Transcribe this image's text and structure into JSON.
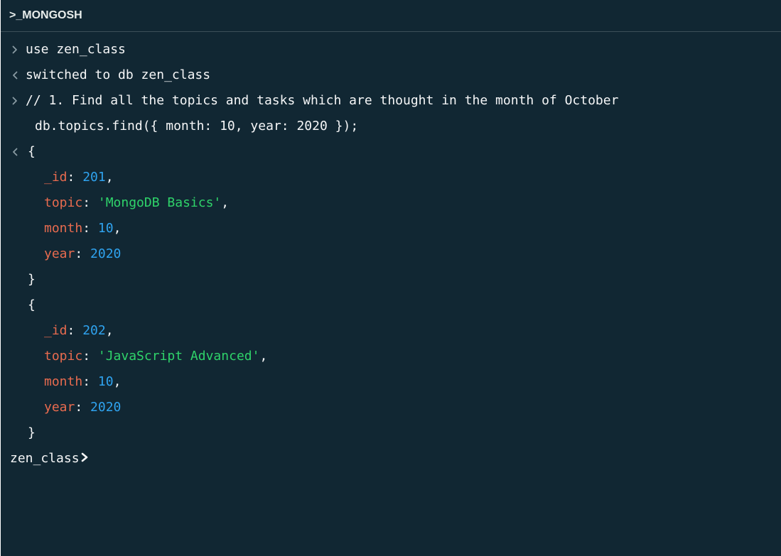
{
  "titlebar": {
    "title": ">_MONGOSH"
  },
  "terminal": {
    "cmd1": "use zen_class",
    "out1": "switched to db zen_class",
    "cmd2_line1": "// 1. Find all the topics and tasks which are thought in the month of October",
    "cmd2_line2": "db.topics.find({ month: 10, year: 2020 });",
    "results": [
      {
        "open": "{",
        "id_key": "_id",
        "id_val": "201",
        "topic_key": "topic",
        "topic_val": "'MongoDB Basics'",
        "month_key": "month",
        "month_val": "10",
        "year_key": "year",
        "year_val": "2020",
        "close": "}"
      },
      {
        "open": "{",
        "id_key": "_id",
        "id_val": "202",
        "topic_key": "topic",
        "topic_val": "'JavaScript Advanced'",
        "month_key": "month",
        "month_val": "10",
        "year_key": "year",
        "year_val": "2020",
        "close": "}"
      }
    ],
    "prompt_db": "zen_class"
  },
  "colors": {
    "background": "#112733",
    "key": "#e86b4f",
    "number": "#2fa3ef",
    "string": "#2fd36a",
    "text": "#f5f6f7"
  },
  "icons": {
    "input_marker": "chevron-right-icon",
    "output_marker": "chevron-left-icon",
    "prompt_marker": "chevron-right-bold-icon"
  }
}
